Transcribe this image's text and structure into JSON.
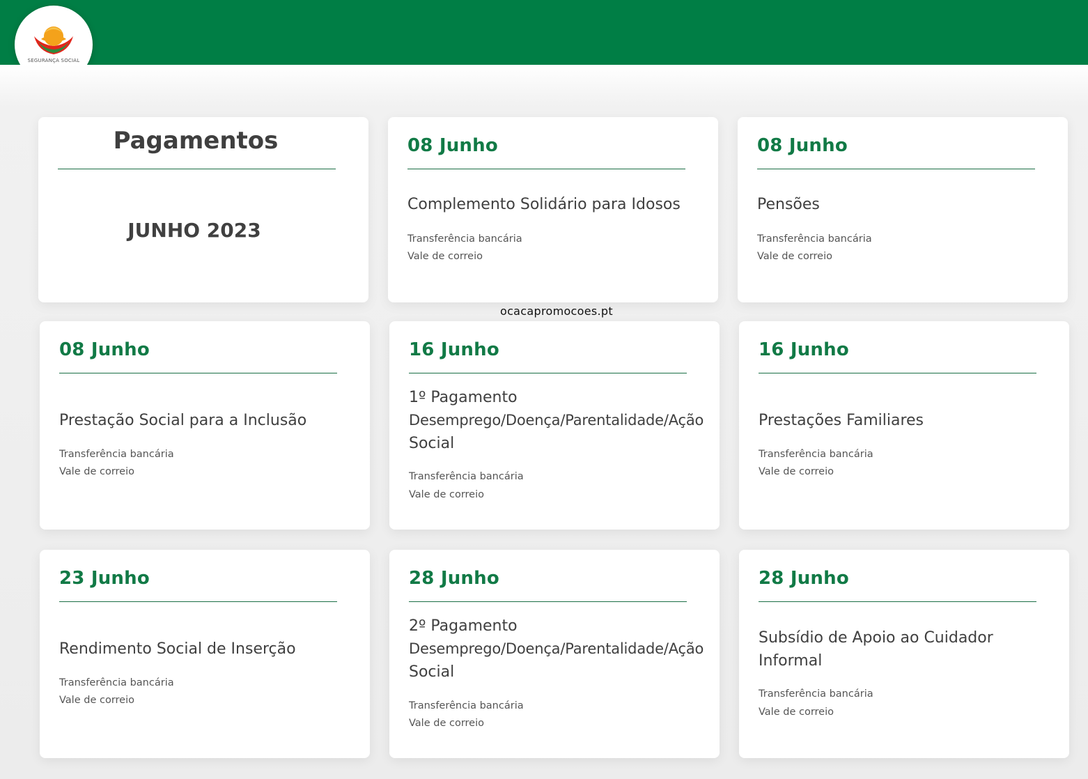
{
  "brand": {
    "name": "SEGURANÇA SOCIAL",
    "colors": {
      "primary": "#007e45",
      "accent_green": "#117a46",
      "logo_orange": "#f4a21b",
      "logo_red": "#e2261c"
    }
  },
  "header": {
    "title": "Pagamentos",
    "month": "JUNHO 2023"
  },
  "watermark": "ocacapromocoes.pt",
  "payments": [
    {
      "date": "08 Junho",
      "title_lines": [
        "Complemento Solidário para Idosos"
      ],
      "methods": [
        "Transferência bancária",
        "Vale de correio"
      ]
    },
    {
      "date": "08 Junho",
      "title_lines": [
        "Pensões"
      ],
      "methods": [
        "Transferência bancária",
        "Vale de correio"
      ]
    },
    {
      "date": "08 Junho",
      "title_lines": [
        "Prestação Social para a Inclusão"
      ],
      "methods": [
        "Transferência bancária",
        "Vale de correio"
      ]
    },
    {
      "date": "16 Junho",
      "title_lines": [
        "1º Pagamento",
        "Desemprego/Doença/Parentalidade/Ação",
        "Social"
      ],
      "methods": [
        "Transferência bancária",
        "Vale de correio"
      ]
    },
    {
      "date": "16 Junho",
      "title_lines": [
        "Prestações Familiares"
      ],
      "methods": [
        "Transferência bancária",
        "Vale de correio"
      ]
    },
    {
      "date": "23 Junho",
      "title_lines": [
        "Rendimento Social de Inserção"
      ],
      "methods": [
        "Transferência bancária",
        "Vale de correio"
      ]
    },
    {
      "date": "28 Junho",
      "title_lines": [
        "2º Pagamento",
        "Desemprego/Doença/Parentalidade/Ação",
        "Social"
      ],
      "methods": [
        "Transferência bancária",
        "Vale de correio"
      ]
    },
    {
      "date": "28 Junho",
      "title_lines": [
        "Subsídio de Apoio ao Cuidador",
        "Informal"
      ],
      "methods": [
        "Transferência bancária",
        "Vale de correio"
      ]
    }
  ]
}
